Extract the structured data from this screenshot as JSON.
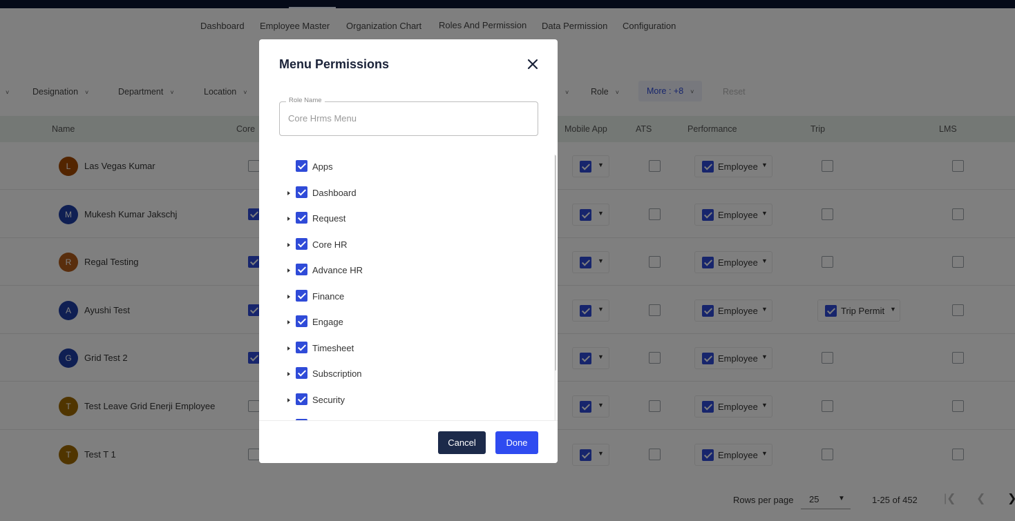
{
  "nav": {
    "items": [
      "Dashboard",
      "Employee Master",
      "Organization Chart",
      "Roles And Permission",
      "Data Permission",
      "Configuration"
    ]
  },
  "filters": {
    "designation": "Designation",
    "department": "Department",
    "location": "Location",
    "role": "Role",
    "more": "More : +8",
    "reset": "Reset"
  },
  "table": {
    "columns": {
      "name": "Name",
      "core": "Core",
      "mobile_app": "Mobile App",
      "ats": "ATS",
      "performance": "Performance",
      "trip": "Trip",
      "lms": "LMS"
    },
    "rows": [
      {
        "initial": "L",
        "name": "Las Vegas Kumar",
        "avatar_color": "#a64b00",
        "core": false,
        "mobile": true,
        "ats": false,
        "performance": "Employee",
        "trip": false,
        "trip_text": "",
        "lms": false
      },
      {
        "initial": "M",
        "name": "Mukesh Kumar Jakschj",
        "avatar_color": "#1f3fa6",
        "core": true,
        "mobile": true,
        "ats": false,
        "performance": "Employee",
        "trip": false,
        "trip_text": "",
        "lms": false
      },
      {
        "initial": "R",
        "name": "Regal Testing",
        "avatar_color": "#b35c1a",
        "core": true,
        "mobile": true,
        "ats": false,
        "performance": "Employee",
        "trip": false,
        "trip_text": "",
        "lms": false
      },
      {
        "initial": "A",
        "name": "Ayushi Test",
        "avatar_color": "#1f3fa6",
        "core": true,
        "mobile": true,
        "ats": false,
        "performance": "Employee",
        "trip": true,
        "trip_text": "Trip Permit",
        "lms": false
      },
      {
        "initial": "G",
        "name": "Grid Test 2",
        "avatar_color": "#1f3fa6",
        "core": true,
        "mobile": true,
        "ats": false,
        "performance": "Employee",
        "trip": false,
        "trip_text": "",
        "lms": false
      },
      {
        "initial": "T",
        "name": "Test Leave Grid Enerji Employee",
        "avatar_color": "#a06a00",
        "core": false,
        "mobile": true,
        "ats": false,
        "performance": "Employee",
        "trip": false,
        "trip_text": "",
        "lms": false
      },
      {
        "initial": "T",
        "name": "Test T 1",
        "avatar_color": "#a06a00",
        "core": false,
        "mobile": true,
        "ats": false,
        "performance": "Employee",
        "trip": false,
        "trip_text": "",
        "lms": false
      }
    ]
  },
  "pagination": {
    "rows_per_page_label": "Rows per page",
    "rows_per_page_value": "25",
    "range": "1-25 of 452"
  },
  "modal": {
    "title": "Menu Permissions",
    "role_name_label": "Role Name",
    "role_name_placeholder": "Core Hrms Menu",
    "tree": [
      {
        "label": "Apps",
        "checked": true,
        "expandable": false
      },
      {
        "label": "Dashboard",
        "checked": true,
        "expandable": true
      },
      {
        "label": "Request",
        "checked": true,
        "expandable": true
      },
      {
        "label": "Core HR",
        "checked": true,
        "expandable": true
      },
      {
        "label": "Advance HR",
        "checked": true,
        "expandable": true
      },
      {
        "label": "Finance",
        "checked": true,
        "expandable": true
      },
      {
        "label": "Engage",
        "checked": true,
        "expandable": true
      },
      {
        "label": "Timesheet",
        "checked": true,
        "expandable": true
      },
      {
        "label": "Subscription",
        "checked": true,
        "expandable": true
      },
      {
        "label": "Security",
        "checked": true,
        "expandable": true
      },
      {
        "label": "",
        "checked": true,
        "expandable": false
      }
    ],
    "cancel_label": "Cancel",
    "done_label": "Done"
  },
  "colors": {
    "accent": "#2f4bf0",
    "checkbox_checked": "#2f4bd8",
    "cancel_bg": "#1c2a4a",
    "topbar": "#0b1430",
    "table_header_bg": "#e8f1ea"
  }
}
